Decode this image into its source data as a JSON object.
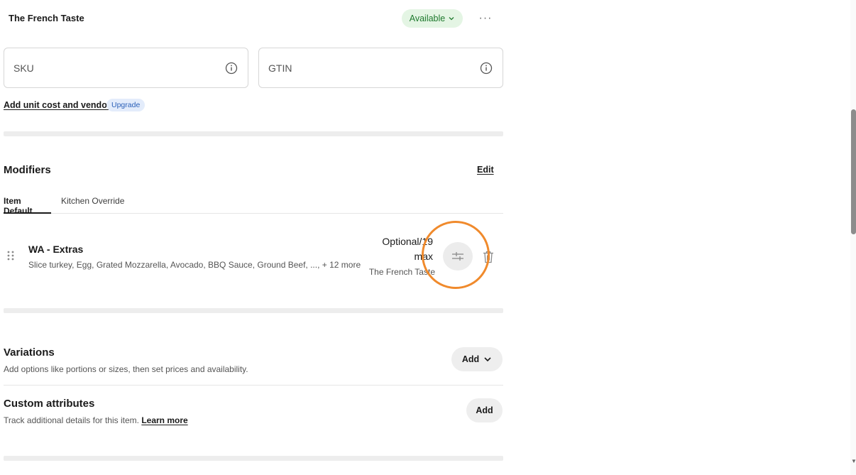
{
  "header": {
    "location_name": "The French Taste",
    "status_label": "Available",
    "more_label": "···"
  },
  "fields": {
    "sku_placeholder": "SKU",
    "gtin_placeholder": "GTIN"
  },
  "unit_cost": {
    "link_label": "Add unit cost and vendor",
    "badge_label": "Upgrade"
  },
  "modifiers": {
    "title": "Modifiers",
    "edit_label": "Edit",
    "tabs": [
      {
        "label": "Item Default",
        "active": true
      },
      {
        "label": "Kitchen Override",
        "active": false
      }
    ],
    "items": [
      {
        "name": "WA - Extras",
        "options": "Slice turkey, Egg, Grated Mozzarella, Avocado, BBQ Sauce, Ground Beef, ..., + 12 more",
        "rule_line1": "Optional/19",
        "rule_line2": "max",
        "location": "The French Taste"
      }
    ]
  },
  "variations": {
    "title": "Variations",
    "description": "Add options like portions or sizes, then set prices and availability.",
    "add_label": "Add"
  },
  "custom_attributes": {
    "title": "Custom attributes",
    "description": "Track additional details for this item.",
    "learn_more_label": "Learn more",
    "add_label": "Add"
  },
  "colors": {
    "available_bg": "#e4f5e4",
    "available_text": "#1f7a2e",
    "upgrade_bg": "#e3ecfb",
    "upgrade_text": "#2a5fb7",
    "highlight_ring": "#f08a2c"
  },
  "icons": {
    "info": "info-icon",
    "drag": "drag-handle-icon",
    "adjust": "sliders-icon",
    "delete": "trash-icon",
    "chevron": "chevron-down-icon"
  }
}
